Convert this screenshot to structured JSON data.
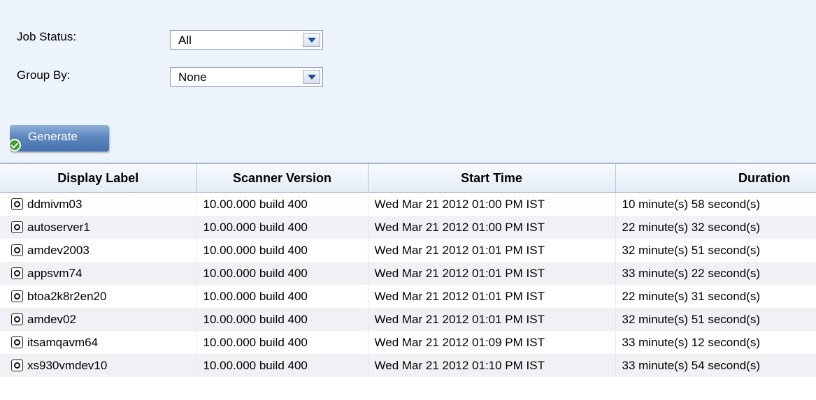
{
  "filters": {
    "job_status": {
      "label": "Job Status:",
      "value": "All"
    },
    "group_by": {
      "label": "Group By:",
      "value": "None"
    }
  },
  "generate_button": {
    "label": "Generate"
  },
  "table": {
    "columns": [
      "Display Label",
      "Scanner Version",
      "Start Time",
      "Duration"
    ],
    "rows": [
      {
        "label": "ddmivm03",
        "version": "10.00.000 build 400",
        "start": "Wed Mar 21 2012 01:00 PM IST",
        "duration": "10 minute(s) 58 second(s)"
      },
      {
        "label": "autoserver1",
        "version": "10.00.000 build 400",
        "start": "Wed Mar 21 2012 01:00 PM IST",
        "duration": "22 minute(s) 32 second(s)"
      },
      {
        "label": "amdev2003",
        "version": "10.00.000 build 400",
        "start": "Wed Mar 21 2012 01:01 PM IST",
        "duration": "32 minute(s) 51 second(s)"
      },
      {
        "label": "appsvm74",
        "version": "10.00.000 build 400",
        "start": "Wed Mar 21 2012 01:01 PM IST",
        "duration": "33 minute(s) 22 second(s)"
      },
      {
        "label": "btoa2k8r2en20",
        "version": "10.00.000 build 400",
        "start": "Wed Mar 21 2012 01:01 PM IST",
        "duration": "22 minute(s) 31 second(s)"
      },
      {
        "label": "amdev02",
        "version": "10.00.000 build 400",
        "start": "Wed Mar 21 2012 01:01 PM IST",
        "duration": "32 minute(s) 51 second(s)"
      },
      {
        "label": "itsamqavm64",
        "version": "10.00.000 build 400",
        "start": "Wed Mar 21 2012 01:09 PM IST",
        "duration": "33 minute(s) 12 second(s)"
      },
      {
        "label": "xs930vmdev10",
        "version": "10.00.000 build 400",
        "start": "Wed Mar 21 2012 01:10 PM IST",
        "duration": "33 minute(s) 54 second(s)"
      }
    ]
  }
}
